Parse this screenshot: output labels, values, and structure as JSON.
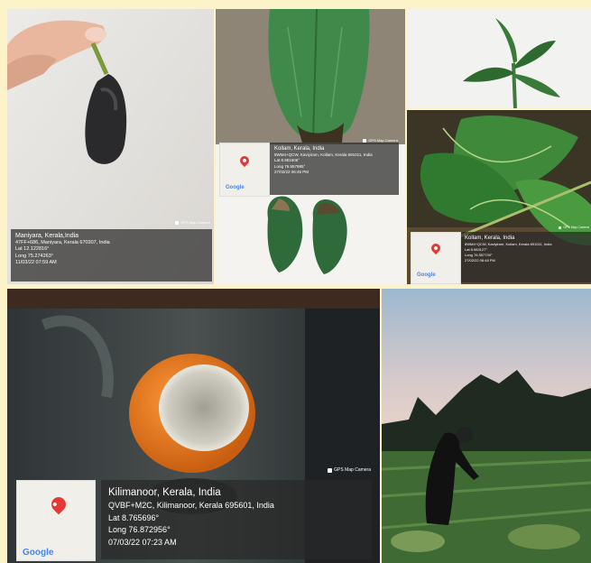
{
  "badge_text": "GPS Map Camera",
  "google_text": "Google",
  "colors": {
    "page_bg": "#fdf3c8",
    "caption_bg": "#282828",
    "pin": "#e53935"
  },
  "p1": {
    "lines": [
      "Maniyara, Kerala,India",
      "47FF+686, Maniyara, Kerala 670307, India",
      "Lat 12.122816°",
      "Long 75.274263°",
      "11/03/22 07:59 AM"
    ]
  },
  "p2": {
    "lines": [
      "Kollam, Kerala, India",
      "8WM4+QCW, Kaviyiram, Kollam, Kerala 691011, India",
      "Lat 8.981606°",
      "Long 76.557985°",
      "27/02/22 06:45 PM"
    ]
  },
  "p4": {
    "lines": [
      "Kollam, Kerala, India",
      "8WM4+QCW, Kaviyiram, Kollam, Kerala 691011, India",
      "Lat 8.983127°",
      "Long 76.557739°",
      "27/02/22 06:48 PM"
    ]
  },
  "p5": {
    "lines": [
      "Kilimanoor, Kerala, India",
      "QVBF+M2C, Kilimanoor, Kerala 695601, India",
      "Lat 8.765696°",
      "Long 76.872956°",
      "07/03/22 07:23 AM"
    ]
  }
}
